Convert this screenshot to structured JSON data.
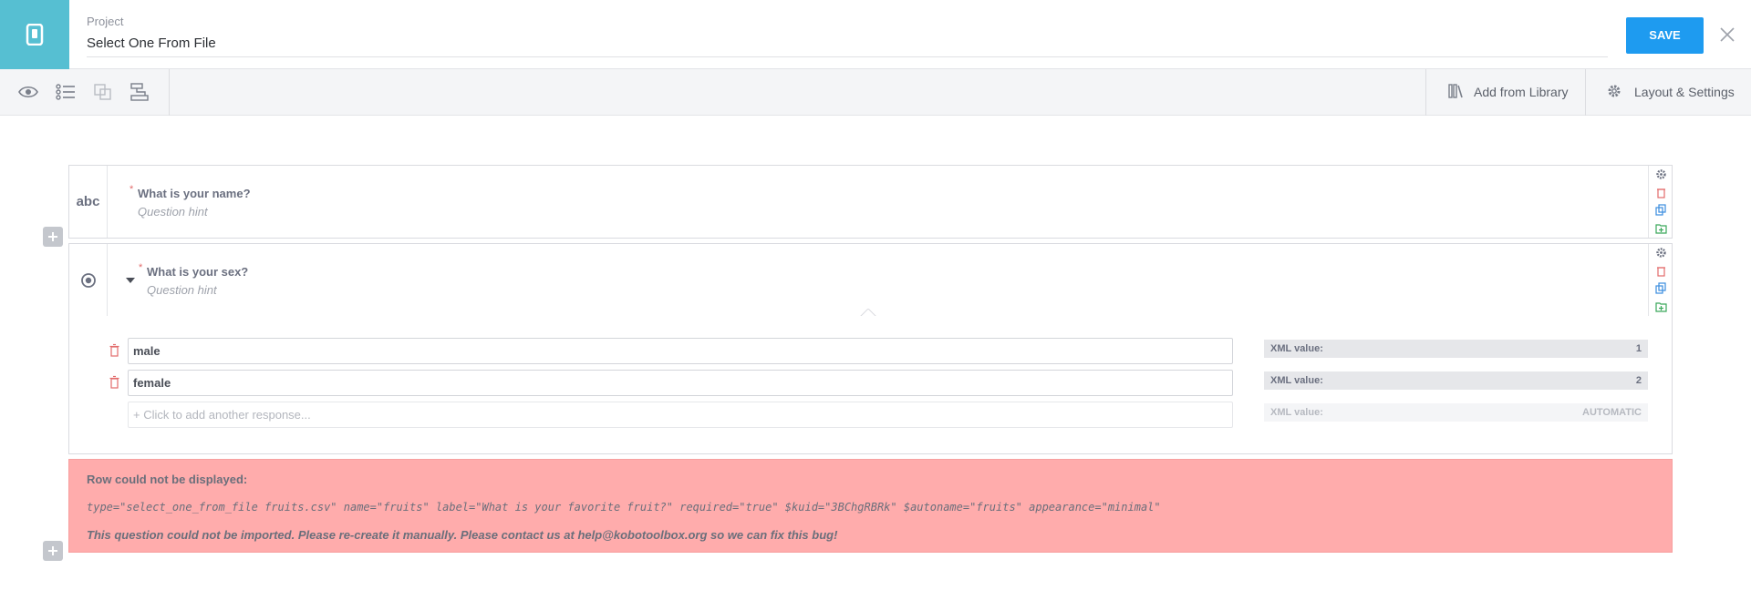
{
  "header": {
    "project_label": "Project",
    "project_name": "Select One From File",
    "save_label": "SAVE",
    "logo_icon": "phone-icon",
    "close_icon": "close-icon"
  },
  "toolbar": {
    "left_icons": [
      "eye-icon",
      "list-icon",
      "group-icon",
      "skip-logic-icon"
    ],
    "library_label": "Add from Library",
    "layout_label": "Layout & Settings"
  },
  "questions": [
    {
      "type_label": "abc",
      "required_mark": "*",
      "label": "What is your name?",
      "hint": "Question hint"
    },
    {
      "type_icon": "radio-icon",
      "required_mark": "*",
      "label": "What is your sex?",
      "hint": "Question hint",
      "options": [
        {
          "label": "male",
          "xml_label": "XML value:",
          "xml_value": "1"
        },
        {
          "label": "female",
          "xml_label": "XML value:",
          "xml_value": "2"
        }
      ],
      "add_option": {
        "label": "+ Click to add another response...",
        "xml_label": "XML value:",
        "xml_value": "AUTOMATIC"
      }
    }
  ],
  "error": {
    "title": "Row could not be displayed:",
    "code": "type=\"select_one_from_file fruits.csv\" name=\"fruits\" label=\"What is your favorite fruit?\" required=\"true\" $kuid=\"3BChgRBRk\" $autoname=\"fruits\" appearance=\"minimal\"",
    "message": "This question could not be imported. Please re-create it manually. Please contact us at help@kobotoolbox.org so we can fix this bug!"
  },
  "colors": {
    "brand": "#56bfd2",
    "save": "#1e9bf0",
    "error_bg": "#ffacac"
  }
}
